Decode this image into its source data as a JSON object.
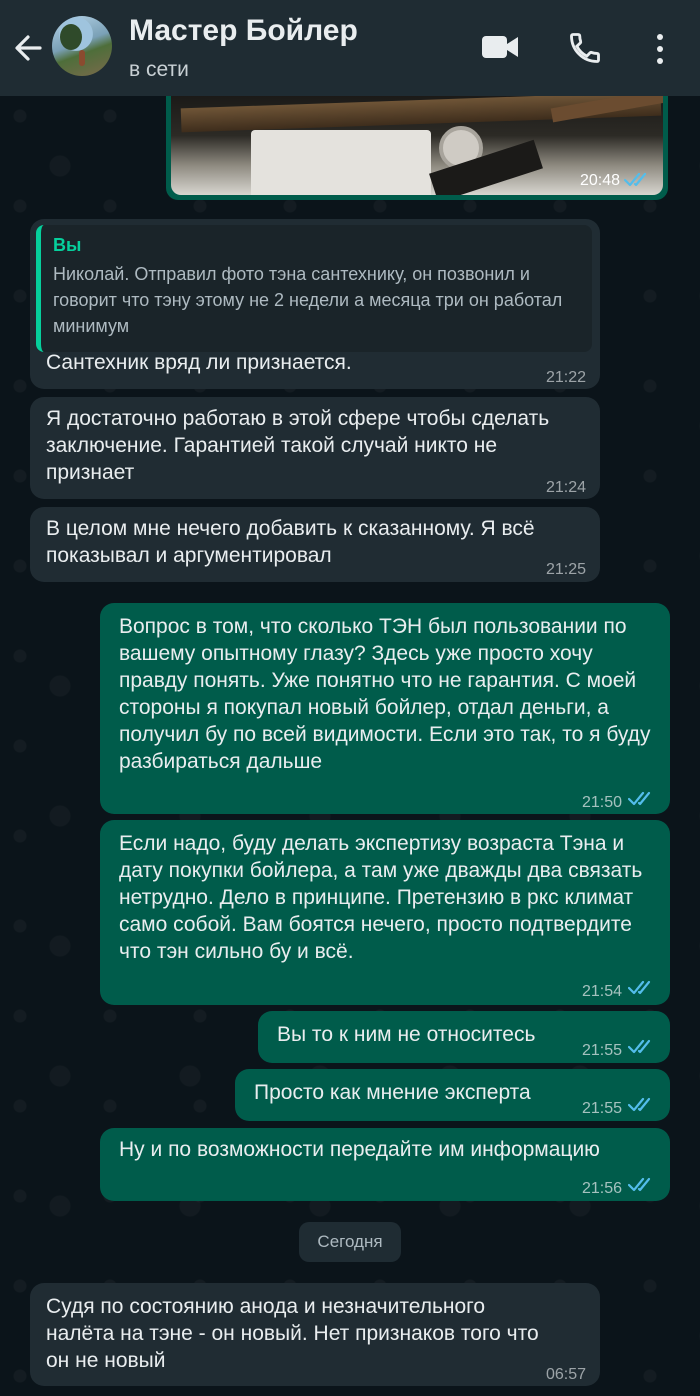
{
  "header": {
    "contact_name": "Мастер Бойлер",
    "status": "в сети",
    "icons": [
      "back-arrow-icon",
      "video-call-icon",
      "phone-icon",
      "more-options-icon"
    ]
  },
  "colors": {
    "header_bg": "#1f2c33",
    "chat_bg": "#0b141a",
    "incoming_bubble": "#202c33",
    "outgoing_bubble": "#005c4b",
    "read_ticks": "#53bdeb",
    "quote_accent": "#06cf9c"
  },
  "messages": [
    {
      "direction": "out",
      "type": "photo",
      "time": "20:48",
      "read": true
    },
    {
      "direction": "in",
      "reply_to": {
        "sender": "Вы",
        "text": "Николай. Отправил фото тэна сантехнику, он позвонил и говорит что тэну этому не 2 недели а месяца три он работал минимум"
      },
      "text": "Сантехник вряд ли признается.",
      "time": "21:22"
    },
    {
      "direction": "in",
      "text": "Я достаточно работаю в этой сфере чтобы сделать заключение. Гарантией такой случай никто не признает",
      "time": "21:24"
    },
    {
      "direction": "in",
      "text": "В целом мне нечего добавить к сказанному. Я всё показывал и аргументировал",
      "time": "21:25"
    },
    {
      "direction": "out",
      "text": "Вопрос в том, что сколько ТЭН был пользовании по вашему опытному глазу? Здесь уже просто хочу правду понять. Уже понятно что не гарантия. С моей стороны я покупал новый бойлер, отдал деньги, а получил бу по всей видимости. Если это так, то я буду разбираться дальше",
      "time": "21:50",
      "read": true
    },
    {
      "direction": "out",
      "text": "Если надо, буду делать экспертизу возраста Тэна и дату покупки бойлера, а там уже дважды два связать нетрудно. Дело в принципе. Претензию в ркс климат само собой. Вам боятся нечего, просто подтвердите что тэн сильно бу и всё.",
      "time": "21:54",
      "read": true
    },
    {
      "direction": "out",
      "text": "Вы то к ним не относитесь",
      "time": "21:55",
      "read": true
    },
    {
      "direction": "out",
      "text": "Просто как мнение эксперта",
      "time": "21:55",
      "read": true
    },
    {
      "direction": "out",
      "text": "Ну и по возможности передайте им информацию",
      "time": "21:56",
      "read": true
    },
    {
      "direction": "divider",
      "text": "Сегодня"
    },
    {
      "direction": "in",
      "text": "Судя по состоянию анода и незначительного налёта на тэне - он новый. Нет признаков того что он не новый",
      "time": "06:57"
    }
  ]
}
